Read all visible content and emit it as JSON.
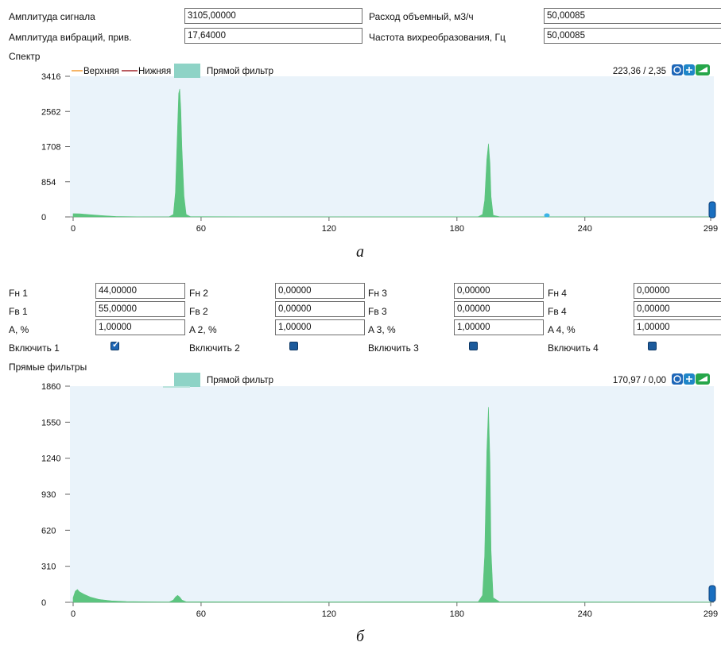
{
  "top_form": {
    "signal_amplitude": {
      "label": "Амплитуда сигнала",
      "value": "3105,00000"
    },
    "vibration_amplitude": {
      "label": "Амплитуда вибраций, прив.",
      "value": "17,64000"
    },
    "volume_flow": {
      "label": "Расход объемный, м3/ч",
      "value": "50,00085"
    },
    "vortex_frequency": {
      "label": "Частота вихреобразования, Гц",
      "value": "50,00085"
    }
  },
  "spectrum": {
    "section_label": "Спектр",
    "legend": {
      "upper": "Верхняя",
      "lower": "Нижняя",
      "direct_filter": "Прямой фильтр"
    },
    "cursor_readout": "223,36 / 2,35",
    "caption": "а"
  },
  "filters": {
    "items": [
      {
        "fn_label": "Fн 1",
        "fn_value": "44,00000",
        "fv_label": "Fв 1",
        "fv_value": "55,00000",
        "a_label": "A, %",
        "a_value": "1,00000",
        "enable_label": "Включить 1",
        "enabled": true
      },
      {
        "fn_label": "Fн 2",
        "fn_value": "0,00000",
        "fv_label": "Fв 2",
        "fv_value": "0,00000",
        "a_label": "A 2, %",
        "a_value": "1,00000",
        "enable_label": "Включить 2",
        "enabled": false
      },
      {
        "fn_label": "Fн 3",
        "fn_value": "0,00000",
        "fv_label": "Fв 3",
        "fv_value": "0,00000",
        "a_label": "A 3, %",
        "a_value": "1,00000",
        "enable_label": "Включить 3",
        "enabled": false
      },
      {
        "fn_label": "Fн 4",
        "fn_value": "0,00000",
        "fv_label": "Fв 4",
        "fv_value": "0,00000",
        "a_label": "A 4, %",
        "a_value": "1,00000",
        "enable_label": "Включить 4",
        "enabled": false
      }
    ]
  },
  "direct_filters": {
    "section_label": "Прямые фильтры",
    "legend": {
      "direct_filter": "Прямой фильтр"
    },
    "cursor_readout": "170,97 / 0,00",
    "caption": "б"
  },
  "colors": {
    "plot_bg": "#eaf3fa",
    "fill_green": "#5cc47f",
    "legend_teal": "#8ed3c6",
    "upper_line": "#f39c34",
    "lower_line": "#a4272d",
    "cursor_marker": "#3cb4e6"
  },
  "chart_data": [
    {
      "type": "area",
      "xlim": [
        0,
        299
      ],
      "ylim": [
        0,
        3416
      ],
      "xticks": [
        "0",
        "60",
        "120",
        "180",
        "240",
        "299"
      ],
      "yticks": [
        "0",
        "854",
        "1708",
        "2562",
        "3416"
      ],
      "legend": [
        "Верхняя",
        "Нижняя",
        "Прямой фильтр"
      ],
      "grid": false,
      "series": [
        {
          "name": "Прямой фильтр",
          "points": [
            [
              0,
              80
            ],
            [
              3,
              75
            ],
            [
              8,
              55
            ],
            [
              14,
              30
            ],
            [
              20,
              12
            ],
            [
              30,
              4
            ],
            [
              45,
              2
            ],
            [
              47,
              60
            ],
            [
              48,
              600
            ],
            [
              49,
              2200
            ],
            [
              49.5,
              3000
            ],
            [
              50,
              3110
            ],
            [
              50.5,
              2600
            ],
            [
              51,
              1700
            ],
            [
              52,
              500
            ],
            [
              53,
              60
            ],
            [
              55,
              5
            ],
            [
              100,
              2
            ],
            [
              150,
              3
            ],
            [
              190,
              4
            ],
            [
              192,
              60
            ],
            [
              193,
              400
            ],
            [
              194,
              1400
            ],
            [
              194.8,
              1780
            ],
            [
              195.5,
              1300
            ],
            [
              196,
              500
            ],
            [
              197,
              40
            ],
            [
              200,
              3
            ],
            [
              260,
              2
            ],
            [
              299,
              1
            ]
          ]
        }
      ]
    },
    {
      "type": "area",
      "xlim": [
        0,
        299
      ],
      "ylim": [
        0,
        1860
      ],
      "xticks": [
        "0",
        "60",
        "120",
        "180",
        "240",
        "299"
      ],
      "yticks": [
        "0",
        "310",
        "620",
        "930",
        "1240",
        "1550",
        "1860"
      ],
      "legend": [
        "Прямой фильтр"
      ],
      "grid": false,
      "series": [
        {
          "name": "Прямой фильтр",
          "points": [
            [
              0,
              40
            ],
            [
              1,
              95
            ],
            [
              2,
              110
            ],
            [
              3,
              90
            ],
            [
              5,
              70
            ],
            [
              8,
              45
            ],
            [
              12,
              25
            ],
            [
              18,
              12
            ],
            [
              25,
              6
            ],
            [
              35,
              4
            ],
            [
              45,
              3
            ],
            [
              47,
              20
            ],
            [
              48,
              45
            ],
            [
              49,
              60
            ],
            [
              50,
              45
            ],
            [
              51,
              20
            ],
            [
              53,
              4
            ],
            [
              100,
              3
            ],
            [
              150,
              4
            ],
            [
              190,
              4
            ],
            [
              192,
              60
            ],
            [
              193,
              400
            ],
            [
              194,
              1300
            ],
            [
              194.8,
              1680
            ],
            [
              195.5,
              1200
            ],
            [
              196,
              450
            ],
            [
              197,
              40
            ],
            [
              200,
              4
            ],
            [
              260,
              3
            ],
            [
              299,
              2
            ]
          ]
        }
      ]
    }
  ]
}
